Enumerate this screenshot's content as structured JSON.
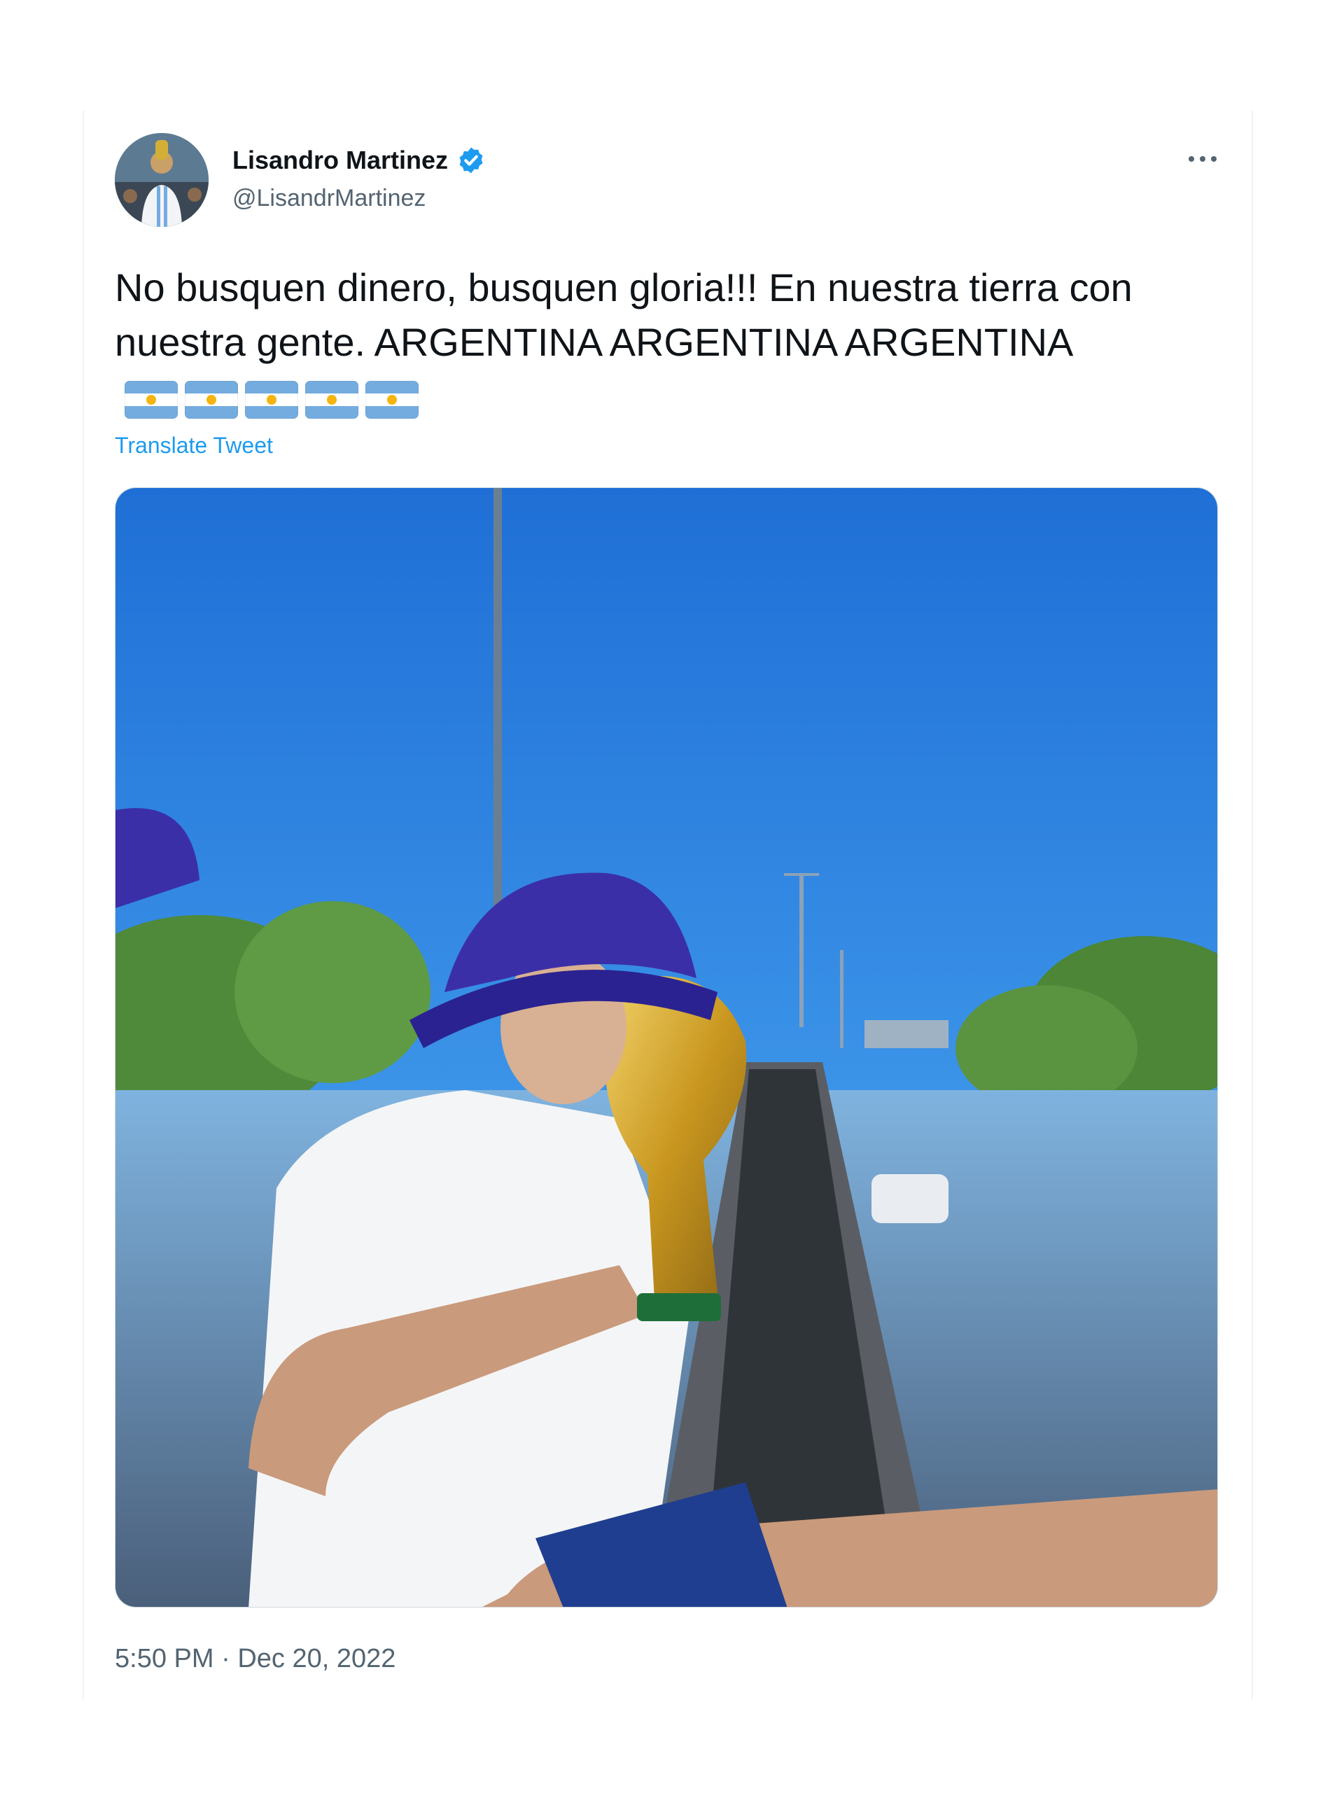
{
  "tweet": {
    "author": {
      "display_name": "Lisandro Martinez",
      "handle": "@LisandrMartinez",
      "verified": true
    },
    "text": "No busquen dinero, busquen gloria!!! En nuestra tierra con nuestra gente. ARGENTINA ARGENTINA ARGENTINA",
    "emoji_flags": [
      "flag-argentina",
      "flag-argentina",
      "flag-argentina",
      "flag-argentina",
      "flag-argentina"
    ],
    "translate_label": "Translate Tweet",
    "time": "5:50 PM",
    "separator": " · ",
    "date": "Dec 20, 2022"
  },
  "icons": {
    "verified": "verified-badge-icon",
    "more": "more-options-icon"
  },
  "colors": {
    "accent": "#1d9bf0",
    "text_primary": "#0f1419",
    "text_secondary": "#536471",
    "sky": "#3d8fe0",
    "argentina_blue": "#74acdf",
    "argentina_sun": "#f6b40e"
  }
}
